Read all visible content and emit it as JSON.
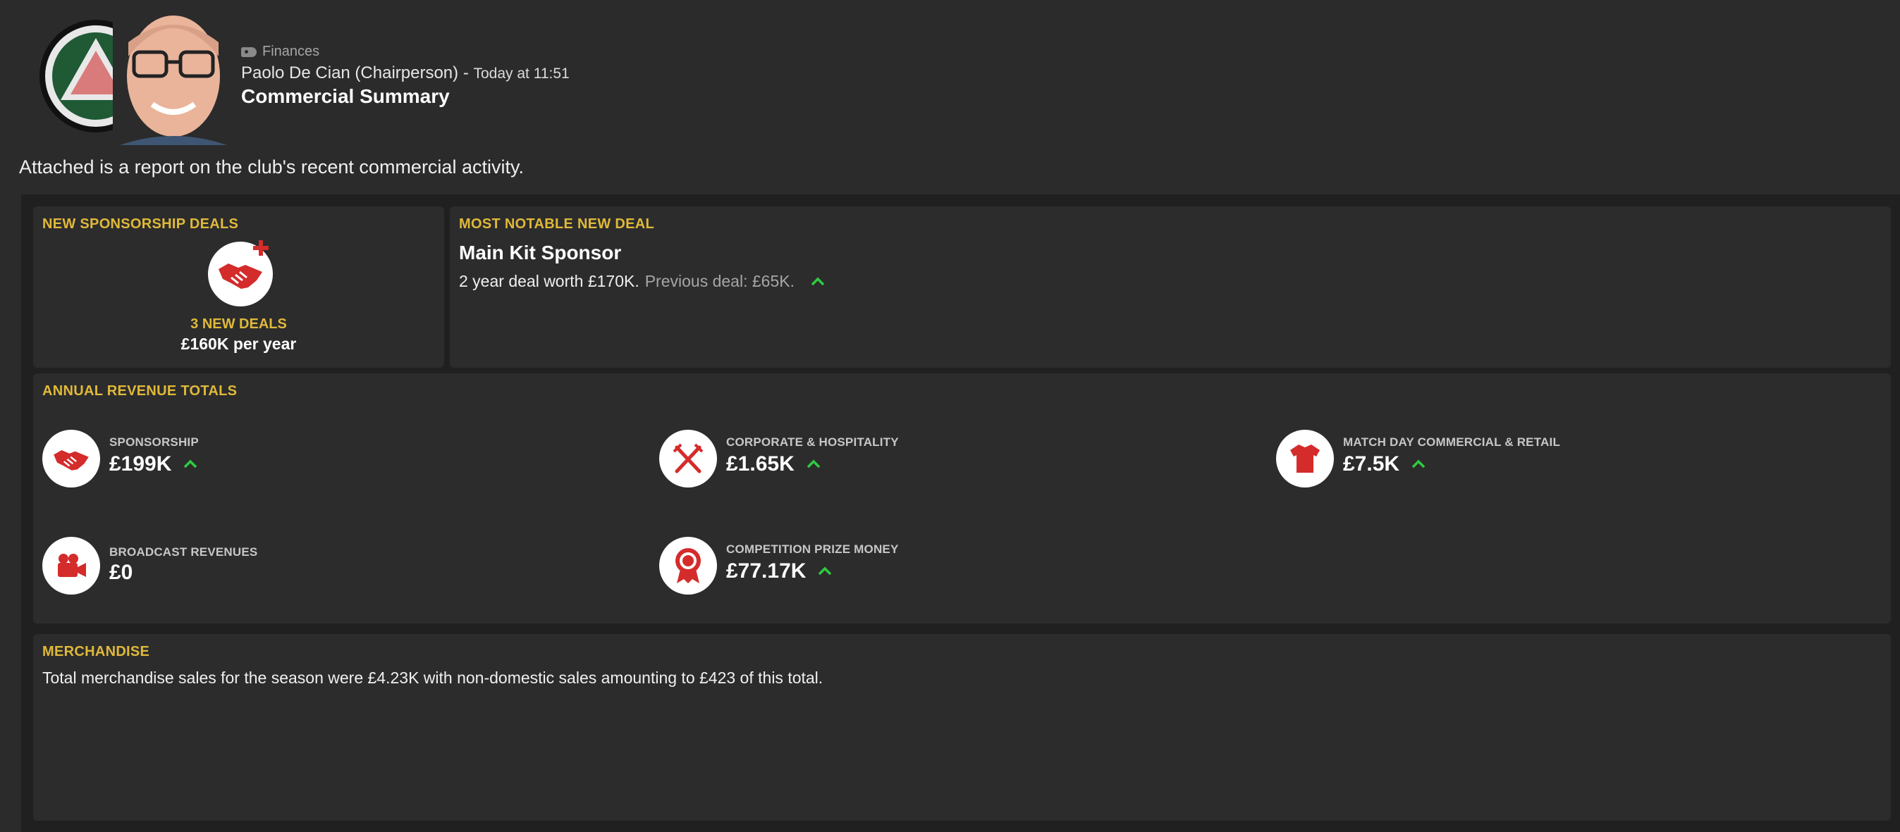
{
  "header": {
    "category": "Finances",
    "sender": "Paolo De Cian (Chairperson)",
    "separator": " - ",
    "time": "Today at 11:51",
    "title": "Commercial Summary"
  },
  "intro": "Attached is a report on the club's recent commercial activity.",
  "colors": {
    "accent": "#e0b93a",
    "icon_red": "#d42b2b",
    "trend_up": "#2ecc40"
  },
  "sponsorship_deals": {
    "title": "NEW SPONSORSHIP DEALS",
    "icon": "handshake-plus-icon",
    "count_text": "3 NEW DEALS",
    "per_year": "£160K per year"
  },
  "notable_deal": {
    "title": "MOST NOTABLE NEW DEAL",
    "name": "Main Kit Sponsor",
    "detail": "2 year deal worth £170K.",
    "previous": "Previous deal: £65K.",
    "trend": "up"
  },
  "annual_revenue": {
    "title": "ANNUAL REVENUE TOTALS",
    "items": [
      {
        "label": "SPONSORSHIP",
        "value": "£199K",
        "icon": "handshake-icon",
        "trend": "up"
      },
      {
        "label": "CORPORATE & HOSPITALITY",
        "value": "£1.65K",
        "icon": "cutlery-icon",
        "trend": "up"
      },
      {
        "label": "MATCH DAY COMMERCIAL & RETAIL",
        "value": "£7.5K",
        "icon": "shirt-icon",
        "trend": "up"
      },
      {
        "label": "BROADCAST REVENUES",
        "value": "£0",
        "icon": "video-camera-icon",
        "trend": "none"
      },
      {
        "label": "COMPETITION PRIZE MONEY",
        "value": "£77.17K",
        "icon": "rosette-icon",
        "trend": "up"
      }
    ]
  },
  "merchandise": {
    "title": "MERCHANDISE",
    "text": "Total merchandise sales for the season were £4.23K with non-domestic sales amounting to £423 of this total."
  }
}
